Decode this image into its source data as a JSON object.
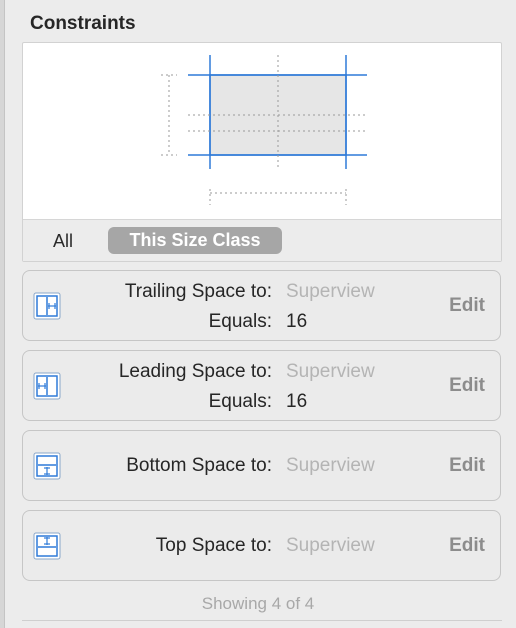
{
  "panel": {
    "title": "Constraints"
  },
  "scope": {
    "all_label": "All",
    "size_class_label": "This Size Class"
  },
  "constraints": [
    {
      "label": "Trailing Space to:",
      "target": "Superview",
      "equals_label": "Equals:",
      "equals_value": "16",
      "edit_label": "Edit",
      "icon": "trailing-space-icon"
    },
    {
      "label": "Leading Space to:",
      "target": "Superview",
      "equals_label": "Equals:",
      "equals_value": "16",
      "edit_label": "Edit",
      "icon": "leading-space-icon"
    },
    {
      "label": "Bottom Space to:",
      "target": "Superview",
      "edit_label": "Edit",
      "icon": "bottom-space-icon"
    },
    {
      "label": "Top Space to:",
      "target": "Superview",
      "edit_label": "Edit",
      "icon": "top-space-icon"
    }
  ],
  "footer": {
    "status": "Showing 4 of 4"
  },
  "colors": {
    "accent_blue": "#2f7ad8",
    "placeholder_gray": "#b4b4b4",
    "pill_gray": "#a6a6a6"
  }
}
